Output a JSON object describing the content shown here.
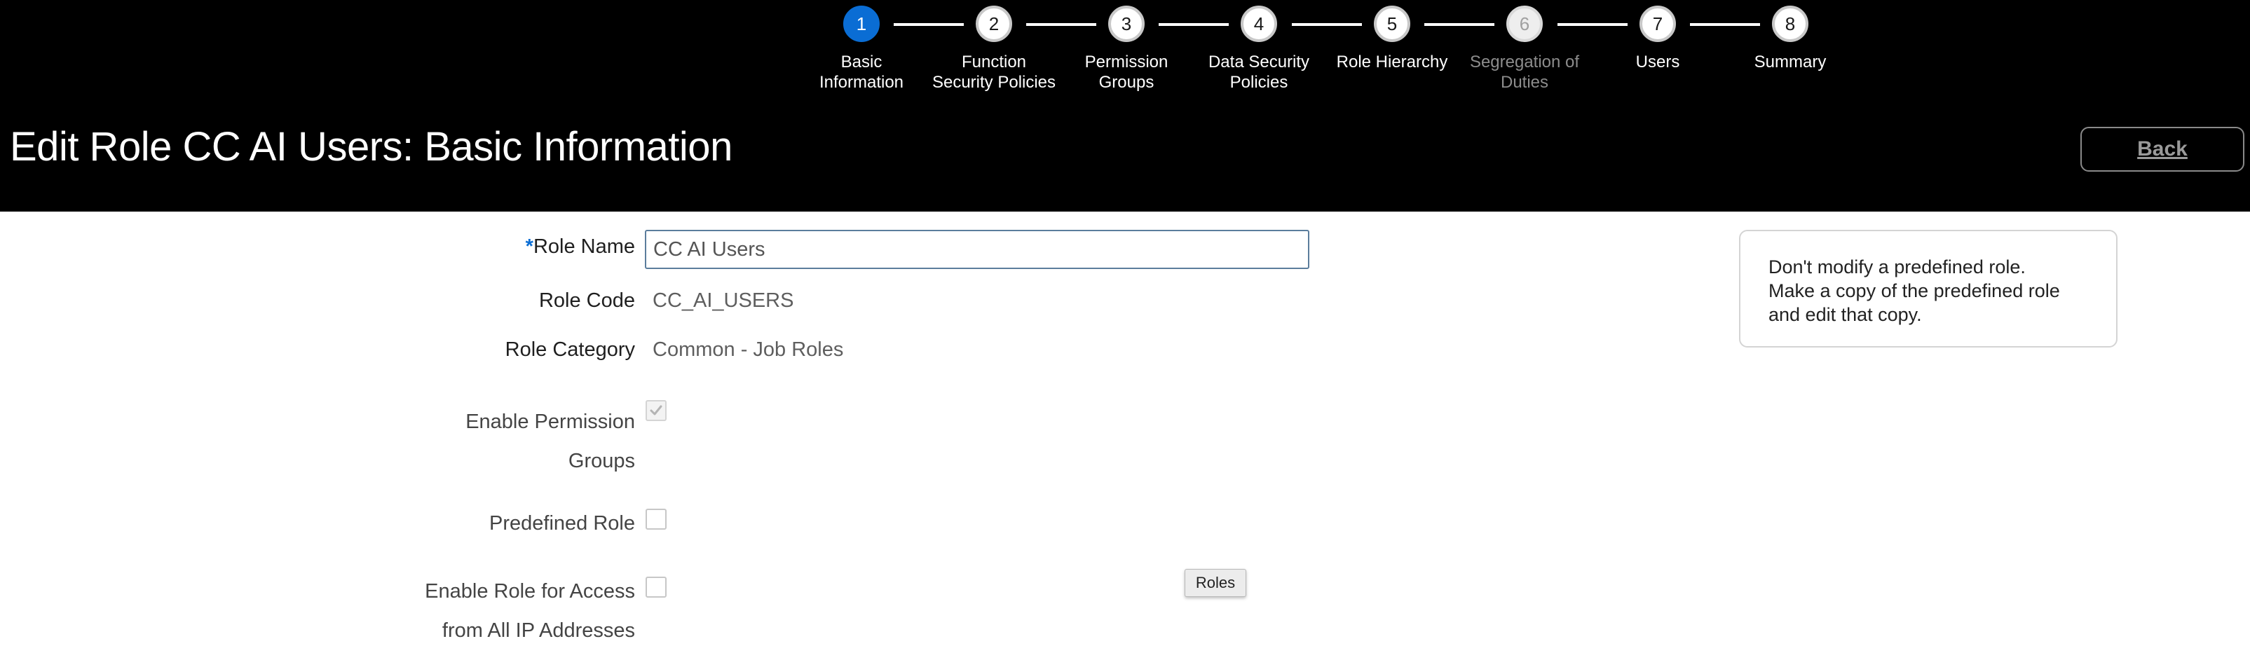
{
  "header": {
    "title": "Edit Role CC AI Users: Basic Information",
    "back_label": "Back"
  },
  "train": {
    "stops": [
      {
        "number": "1",
        "label": "Basic\nInformation",
        "state": "current"
      },
      {
        "number": "2",
        "label": "Function\nSecurity Policies",
        "state": "enabled"
      },
      {
        "number": "3",
        "label": "Permission\nGroups",
        "state": "enabled"
      },
      {
        "number": "4",
        "label": "Data Security\nPolicies",
        "state": "enabled"
      },
      {
        "number": "5",
        "label": "Role Hierarchy",
        "state": "enabled"
      },
      {
        "number": "6",
        "label": "Segregation of\nDuties",
        "state": "disabled"
      },
      {
        "number": "7",
        "label": "Users",
        "state": "enabled"
      },
      {
        "number": "8",
        "label": "Summary",
        "state": "enabled"
      }
    ]
  },
  "form": {
    "required_marker": "*",
    "role_name": {
      "label": "Role Name",
      "value": "CC AI Users"
    },
    "role_code": {
      "label": "Role Code",
      "value": "CC_AI_USERS"
    },
    "role_category": {
      "label": "Role Category",
      "value": "Common - Job Roles"
    },
    "enable_permission_groups": {
      "label_line1": "Enable Permission",
      "label_line2": "Groups",
      "checked": true
    },
    "predefined_role": {
      "label": "Predefined Role",
      "checked": false
    },
    "enable_ip_access": {
      "label_line1": "Enable Role for Access",
      "label_line2": "from All IP Addresses",
      "checked": false
    }
  },
  "tooltip": {
    "text": "Roles"
  },
  "info_box": {
    "line1": "Don't modify a predefined role.",
    "line2": "Make a copy of the predefined role",
    "line3": "and edit that copy."
  },
  "colors": {
    "header_bg": "#000000",
    "current_step": "#0a6dd4",
    "required_marker": "#0a6dd4"
  }
}
